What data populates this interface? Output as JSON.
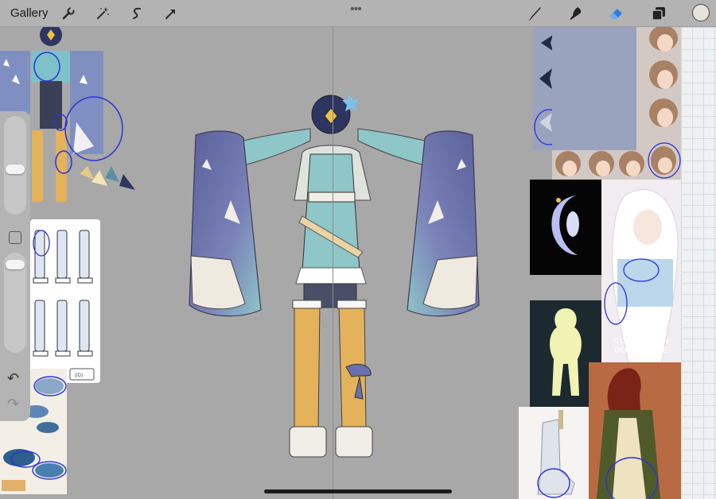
{
  "toolbar": {
    "gallery_label": "Gallery",
    "left_tools": [
      "wrench-icon",
      "magic-wand-icon",
      "selection-icon",
      "transform-arrow-icon"
    ],
    "right_tools": [
      "brush-icon",
      "smudge-icon",
      "eraser-icon",
      "layers-icon"
    ],
    "active_tool": "eraser",
    "color_swatch": "#e6e4d8",
    "accent": "#2f7de1"
  },
  "sidebar": {
    "size_slider": 0.45,
    "opacity_slider": 0.95
  },
  "canvas": {
    "reference_watermark": [
      "COMMISSION",
      "DO NOT USE"
    ],
    "tag_text": "(ID)"
  }
}
